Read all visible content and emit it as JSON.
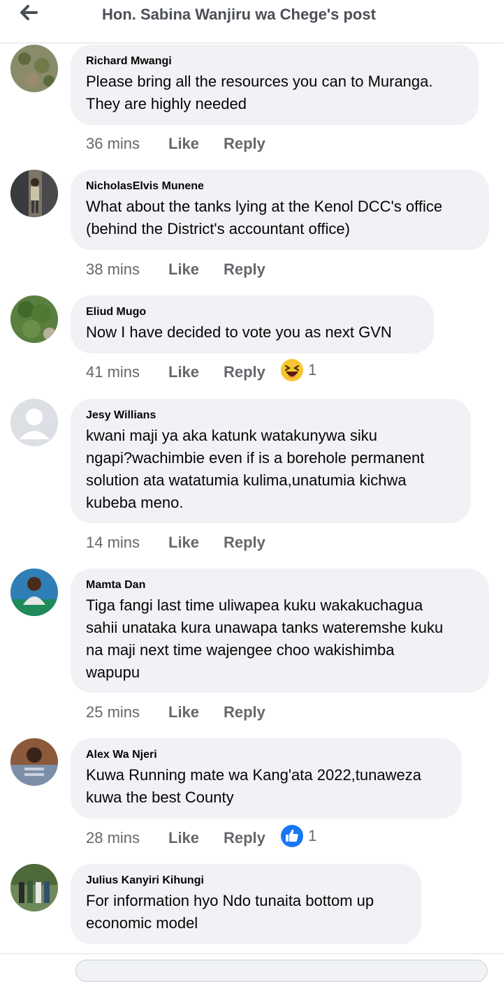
{
  "header": {
    "title": "Hon. Sabina Wanjiru wa Chege's post"
  },
  "comments": [
    {
      "author": "Richard Mwangi",
      "lines": [
        "Please bring all the resources you can to Muranga.",
        "They are highly needed"
      ],
      "time": "36 mins",
      "like": "Like",
      "reply": "Reply"
    },
    {
      "author": "NicholasElvis Munene",
      "lines": [
        "What about the tanks lying at the Kenol DCC's office",
        "(behind the District's accountant office)"
      ],
      "time": "38 mins",
      "like": "Like",
      "reply": "Reply"
    },
    {
      "author": "Eliud Mugo",
      "lines": [
        "Now I have decided to vote you as next GVN"
      ],
      "time": "41 mins",
      "like": "Like",
      "reply": "Reply",
      "reaction": {
        "icon": "laughing-emoji-icon",
        "count": "1"
      }
    },
    {
      "author": "Jesy Willians",
      "lines": [
        "kwani maji ya aka katunk watakunywa siku",
        "ngapi?wachimbie even if is a borehole permanent",
        "solution ata watatumia kulima,unatumia kichwa",
        "kubeba meno."
      ],
      "time": "14 mins",
      "like": "Like",
      "reply": "Reply"
    },
    {
      "author": "Mamta Dan",
      "lines": [
        "Tiga fangi last time uliwapea kuku wakakuchagua",
        "sahii unataka kura unawapa tanks wateremshe kuku",
        "na maji next time wajengee choo wakishimba",
        "wapupu"
      ],
      "time": "25 mins",
      "like": "Like",
      "reply": "Reply"
    },
    {
      "author": "Alex Wa Njeri",
      "lines": [
        "Kuwa Running mate wa Kang'ata 2022,tunaweza",
        "kuwa the best County"
      ],
      "time": "28 mins",
      "like": "Like",
      "reply": "Reply",
      "reaction": {
        "icon": "thumbs-up-icon",
        "count": "1"
      }
    },
    {
      "author": "Julius Kanyiri Kihungi",
      "lines": [
        "For information hyo Ndo tunaita bottom up",
        "economic model"
      ]
    }
  ],
  "colors": {
    "bubble": "#f0f2f5",
    "meta": "#65676b",
    "like_blue": "#1877f2",
    "laugh_yellow": "#f7c531"
  }
}
